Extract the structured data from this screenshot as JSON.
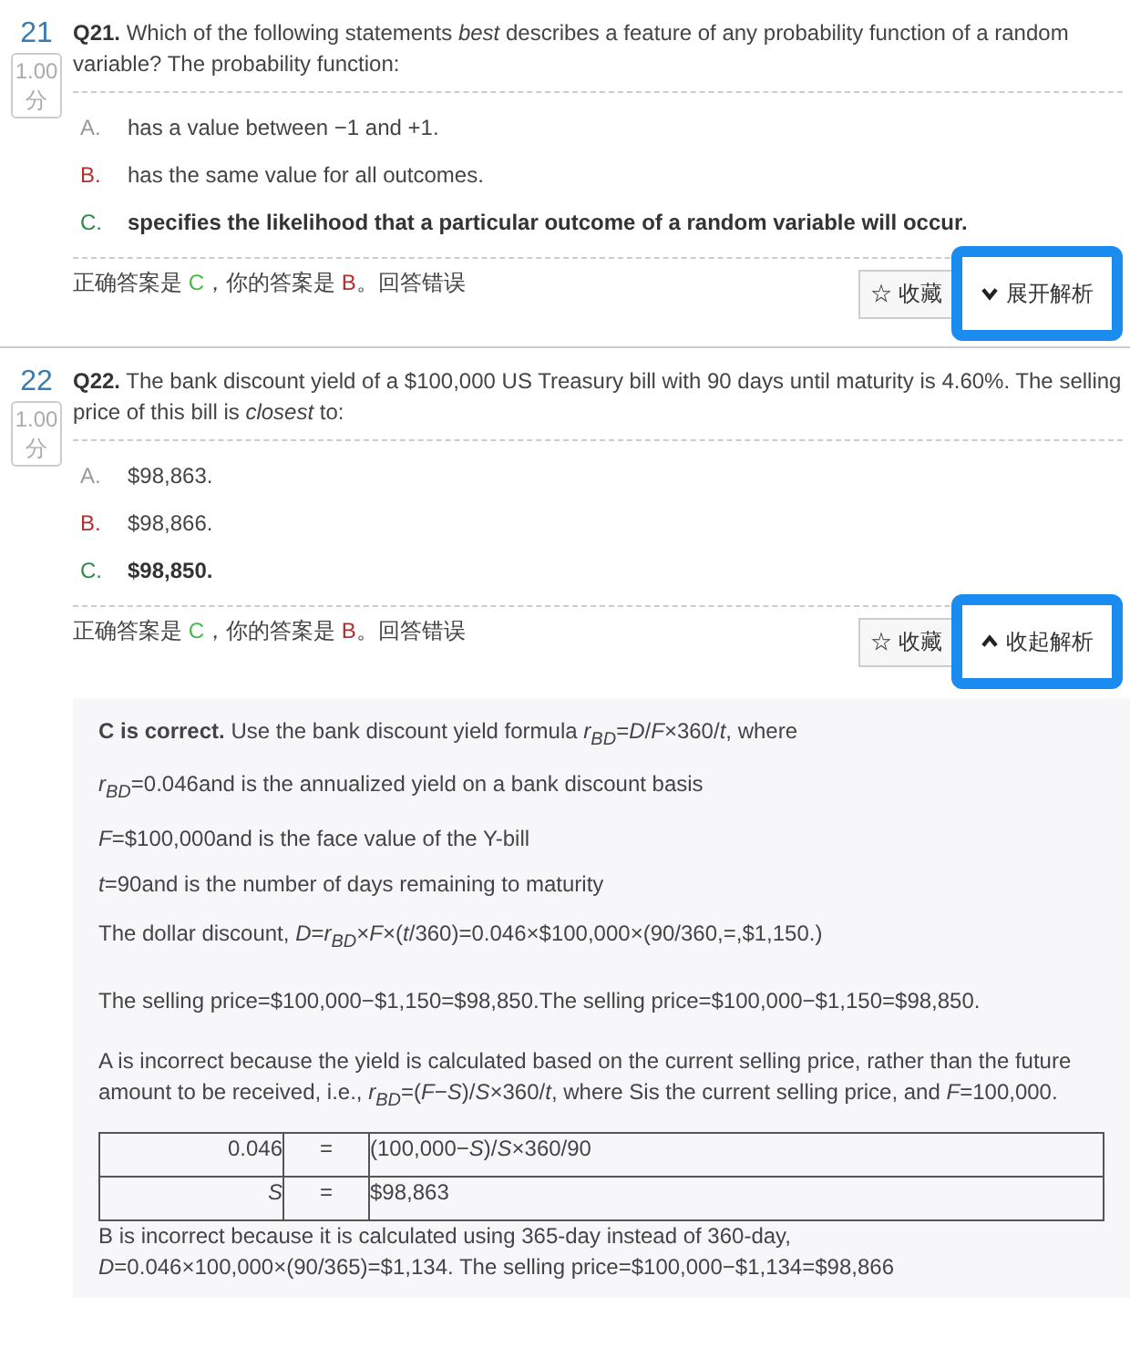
{
  "questions": [
    {
      "number": "21",
      "score": "1.00",
      "score_unit": "分",
      "label": "Q21.",
      "text": "Which of the following statements *best* describes a feature of any probability function of a random variable? The probability function:",
      "options": [
        {
          "letter": "A.",
          "text": "has a value between −1 and +1.",
          "correct": false,
          "chosen": false
        },
        {
          "letter": "B.",
          "text": "has the same value for all outcomes.",
          "correct": false,
          "chosen": true
        },
        {
          "letter": "C.",
          "text": "specifies the likelihood that a particular outcome of a random variable will occur.",
          "correct": true,
          "chosen": false
        }
      ],
      "result": {
        "prefix": "正确答案是 ",
        "correct": "C",
        "middle": "，你的答案是 ",
        "chosen": "B",
        "suffix": "。回答错误"
      },
      "favorite_button": {
        "icon": "☆",
        "label": "收藏"
      },
      "toggle_button": {
        "label": "展开解析",
        "highlighted": true
      },
      "expanded": false
    },
    {
      "number": "22",
      "score": "1.00",
      "score_unit": "分",
      "label": "Q22.",
      "text": "The bank discount yield of a $100,000 US Treasury bill with 90 days until maturity is 4.60%. The selling price of this bill is *closest* to:",
      "options": [
        {
          "letter": "A.",
          "text": "$98,863.",
          "correct": false,
          "chosen": false
        },
        {
          "letter": "B.",
          "text": "$98,866.",
          "correct": false,
          "chosen": true
        },
        {
          "letter": "C.",
          "text": "$98,850.",
          "correct": true,
          "chosen": false
        }
      ],
      "result": {
        "prefix": "正确答案是 ",
        "correct": "C",
        "middle": "，你的答案是 ",
        "chosen": "B",
        "suffix": "。回答错误"
      },
      "favorite_button": {
        "icon": "☆",
        "label": "收藏"
      },
      "toggle_button": {
        "label": "收起解析",
        "highlighted": true
      },
      "expanded": true,
      "explanation": [
        {
          "kind": "paragraph",
          "text": "**C is correct.** Use the bank discount yield formula *r*$_{BD}$=*D*/*F*×360/*t*, where"
        },
        {
          "kind": "paragraph",
          "text": "*r*$_{BD}$=0.046and is the annualized yield on a bank discount basis"
        },
        {
          "kind": "paragraph",
          "text": "*F*=$100,000and is the face value of the Y-bill"
        },
        {
          "kind": "paragraph",
          "text": "*t*=90and is the number of days remaining to maturity"
        },
        {
          "kind": "spaced",
          "text": "The dollar discount, *D*=*r*$_{BD}$×*F*×(*t*/360)=0.046×$100,000×(90/360,=,$1,150.)"
        },
        {
          "kind": "spaced",
          "text": "The selling price=$100,000−$1,150=$98,850.The selling price=$100,000−$1,150=$98,850."
        },
        {
          "kind": "paragraph",
          "text": "A is incorrect because the yield is calculated based on the current selling price, rather than the future amount to be received, i.e., *r*$_{BD}$=(*F*−*S*)/*S*×360/*t*, where Sis the current selling price, and *F*=100,000."
        },
        {
          "kind": "table",
          "rows": [
            [
              "0.046",
              "=",
              "(100,000−*S*)/*S*×360/90"
            ],
            [
              "*S*",
              "=",
              "$98,863"
            ]
          ]
        },
        {
          "kind": "tight",
          "text": "B is incorrect because it is calculated using 365-day instead of 360-day, *D*=0.046×100,000×(90/365)=$1,134. The selling price=$100,000−$1,134=$98,866"
        }
      ]
    }
  ]
}
